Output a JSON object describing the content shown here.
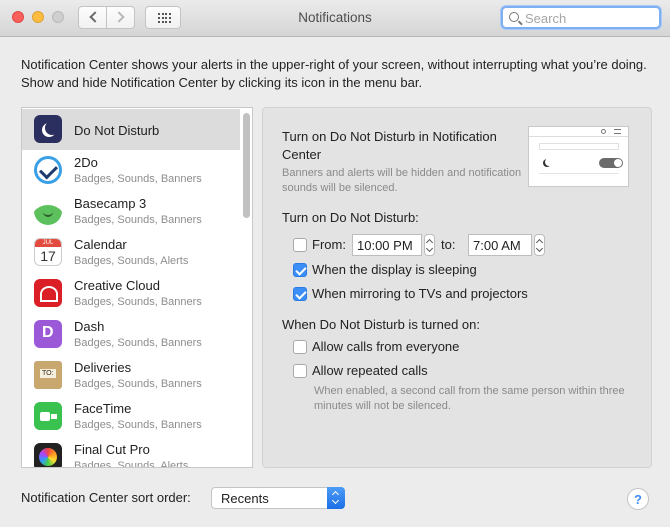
{
  "window": {
    "title": "Notifications"
  },
  "search": {
    "placeholder": "Search"
  },
  "intro_text": "Notification Center shows your alerts in the upper-right of your screen, without interrupting what you’re doing. Show and hide Notification Center by clicking its icon in the menu bar.",
  "apps": [
    {
      "name": "Do Not Disturb",
      "subtitle": "",
      "icon": "moon-icon",
      "selected": true
    },
    {
      "name": "2Do",
      "subtitle": "Badges, Sounds, Banners",
      "icon": "2do-app-icon"
    },
    {
      "name": "Basecamp 3",
      "subtitle": "Badges, Sounds, Banners",
      "icon": "basecamp-app-icon"
    },
    {
      "name": "Calendar",
      "subtitle": "Badges, Sounds, Alerts",
      "icon": "calendar-app-icon",
      "icon_month": "JUL",
      "icon_day": "17"
    },
    {
      "name": "Creative Cloud",
      "subtitle": "Badges, Sounds, Banners",
      "icon": "creative-cloud-app-icon"
    },
    {
      "name": "Dash",
      "subtitle": "Badges, Sounds, Banners",
      "icon": "dash-app-icon"
    },
    {
      "name": "Deliveries",
      "subtitle": "Badges, Sounds, Banners",
      "icon": "deliveries-app-icon"
    },
    {
      "name": "FaceTime",
      "subtitle": "Badges, Sounds, Banners",
      "icon": "facetime-app-icon"
    },
    {
      "name": "Final Cut Pro",
      "subtitle": "Badges, Sounds, Alerts",
      "icon": "final-cut-pro-app-icon"
    }
  ],
  "dnd": {
    "heading": "Turn on Do Not Disturb in Notification Center",
    "note": "Banners and alerts will be hidden and notification sounds will be silenced.",
    "turn_on_label": "Turn on Do Not Disturb:",
    "from_label": "From:",
    "from_checked": false,
    "from_time": "10:00 PM",
    "to_label": "to:",
    "to_time": "7:00 AM",
    "display_sleeping_label": "When the display is sleeping",
    "display_sleeping_checked": true,
    "mirroring_label": "When mirroring to TVs and projectors",
    "mirroring_checked": true,
    "when_on_label": "When Do Not Disturb is turned on:",
    "allow_calls_label": "Allow calls from everyone",
    "allow_calls_checked": false,
    "repeated_calls_label": "Allow repeated calls",
    "repeated_calls_checked": false,
    "repeated_note": "When enabled, a second call from the same person within three minutes will not be silenced."
  },
  "sort": {
    "label": "Notification Center sort order:",
    "value": "Recents"
  },
  "help": {
    "label": "?"
  },
  "colors": {
    "accent": "#3e8ef7",
    "selected_row": "#dcdcdc"
  }
}
